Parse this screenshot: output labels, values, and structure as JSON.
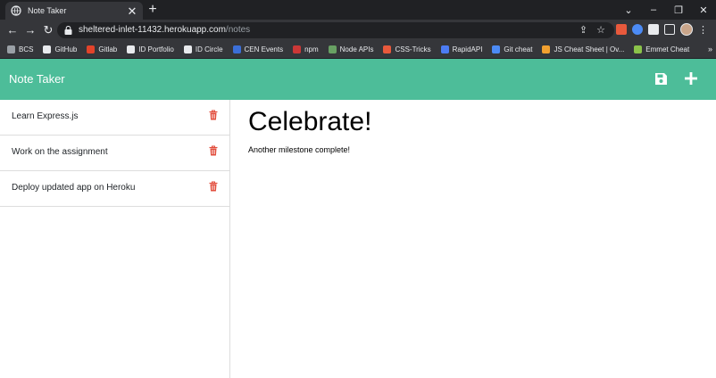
{
  "browser": {
    "tab_title": "Note Taker",
    "tab_close": "✕",
    "new_tab": "+",
    "url_host": "sheltered-inlet-11432.herokuapp.com",
    "url_path": "/notes",
    "bookmarks": [
      {
        "label": "BCS",
        "icon": "globe-icon",
        "color": "#9aa0a6"
      },
      {
        "label": "GitHub",
        "icon": "github-icon",
        "color": "#e8eaed"
      },
      {
        "label": "Gitlab",
        "icon": "gitlab-icon",
        "color": "#e2432a"
      },
      {
        "label": "ID Portfolio",
        "icon": "dp-icon",
        "color": "#e8eaed"
      },
      {
        "label": "ID Circle",
        "icon": "dp-icon",
        "color": "#e8eaed"
      },
      {
        "label": "CEN Events",
        "icon": "cen-icon",
        "color": "#3b6fd8"
      },
      {
        "label": "npm",
        "icon": "npm-icon",
        "color": "#cb3837"
      },
      {
        "label": "Node APIs",
        "icon": "node-icon",
        "color": "#68a063"
      },
      {
        "label": "CSS-Tricks",
        "icon": "css-tricks-icon",
        "color": "#e8593c"
      },
      {
        "label": "RapidAPI",
        "icon": "rapidapi-icon",
        "color": "#4c7cf3"
      },
      {
        "label": "Git cheat",
        "icon": "git-icon",
        "color": "#4c8bf5"
      },
      {
        "label": "JS Cheat Sheet | Ov...",
        "icon": "js-icon",
        "color": "#f0a030"
      },
      {
        "label": "Emmet Cheat",
        "icon": "emmet-icon",
        "color": "#8bc34a"
      }
    ],
    "bookmarks_more": "»"
  },
  "app": {
    "title": "Note Taker",
    "accent_color": "#4dbd99",
    "notes": [
      {
        "title": "Learn Express.js"
      },
      {
        "title": "Work on the assignment"
      },
      {
        "title": "Deploy updated app on Heroku"
      }
    ],
    "active_note": {
      "title": "Celebrate!",
      "text": "Another milestone complete!"
    }
  }
}
